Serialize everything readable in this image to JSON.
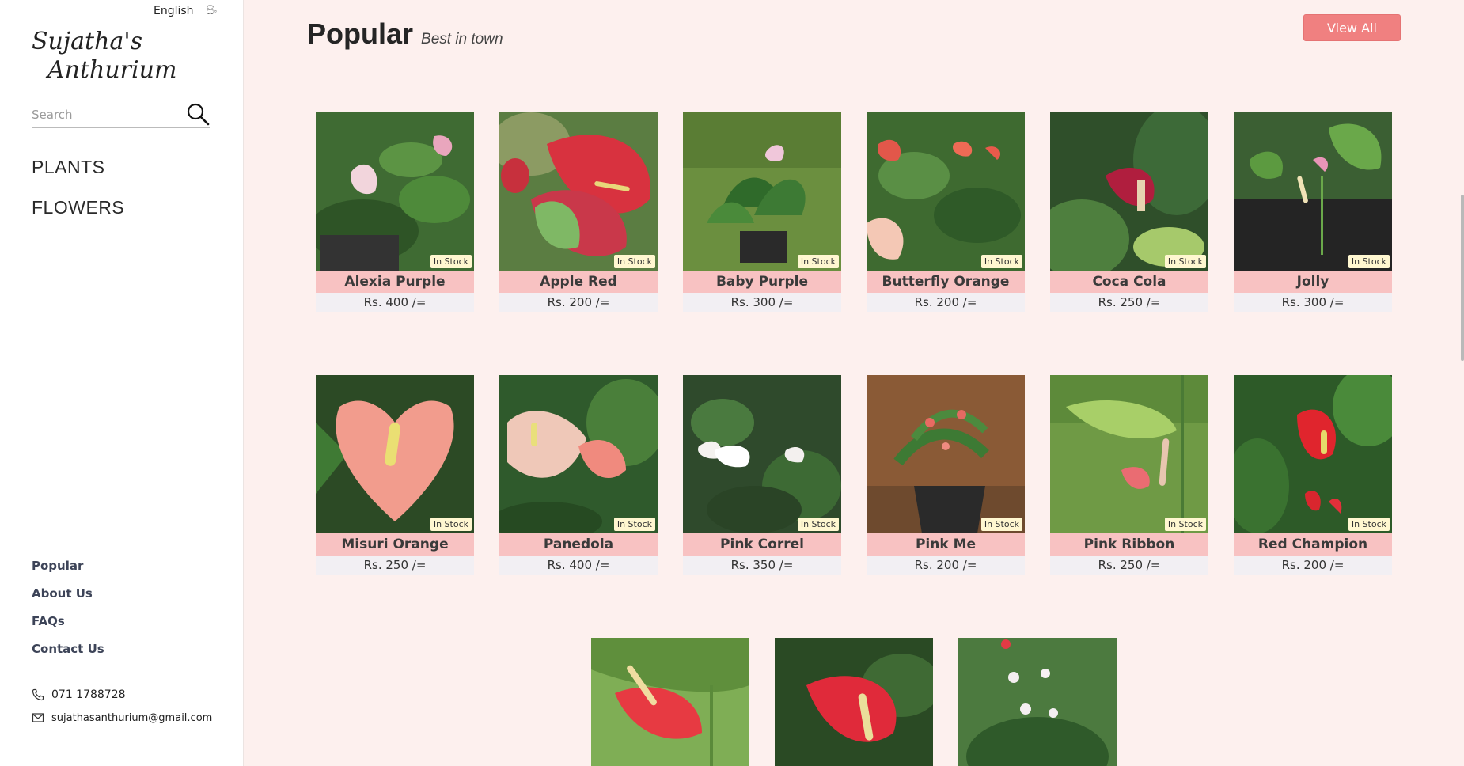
{
  "language": {
    "english": "English",
    "sinhala": "සිං"
  },
  "brand": {
    "line1": "Sujatha's",
    "line2": "Anthurium"
  },
  "search": {
    "placeholder": "Search"
  },
  "nav_main": [
    "PLANTS",
    "FLOWERS"
  ],
  "nav_footer": [
    "Popular",
    "About Us",
    "FAQs",
    "Contact Us"
  ],
  "contact": {
    "phone": "071 1788728",
    "email": "sujathasanthurium@gmail.com"
  },
  "section": {
    "title": "Popular",
    "subtitle": "Best in town",
    "view_all": "View All"
  },
  "stock_label": "In Stock",
  "products": [
    {
      "name": "Alexia Purple",
      "price": "Rs. 400 /="
    },
    {
      "name": "Apple Red",
      "price": "Rs. 200 /="
    },
    {
      "name": "Baby Purple",
      "price": "Rs. 300 /="
    },
    {
      "name": "Butterfly Orange",
      "price": "Rs. 200 /="
    },
    {
      "name": "Coca Cola",
      "price": "Rs. 250 /="
    },
    {
      "name": "Jolly",
      "price": "Rs. 300 /="
    },
    {
      "name": "Misuri Orange",
      "price": "Rs. 250 /="
    },
    {
      "name": "Panedola",
      "price": "Rs. 400 /="
    },
    {
      "name": "Pink Correl",
      "price": "Rs. 350 /="
    },
    {
      "name": "Pink Me",
      "price": "Rs. 200 /="
    },
    {
      "name": "Pink Ribbon",
      "price": "Rs. 250 /="
    },
    {
      "name": "Red Champion",
      "price": "Rs. 200 /="
    }
  ],
  "colors": {
    "accent": "#f08080",
    "name_band": "#f8c2c2",
    "price_band": "#f2eff3",
    "page_bg": "#fdf0ee",
    "badge": "#fff7d0"
  }
}
